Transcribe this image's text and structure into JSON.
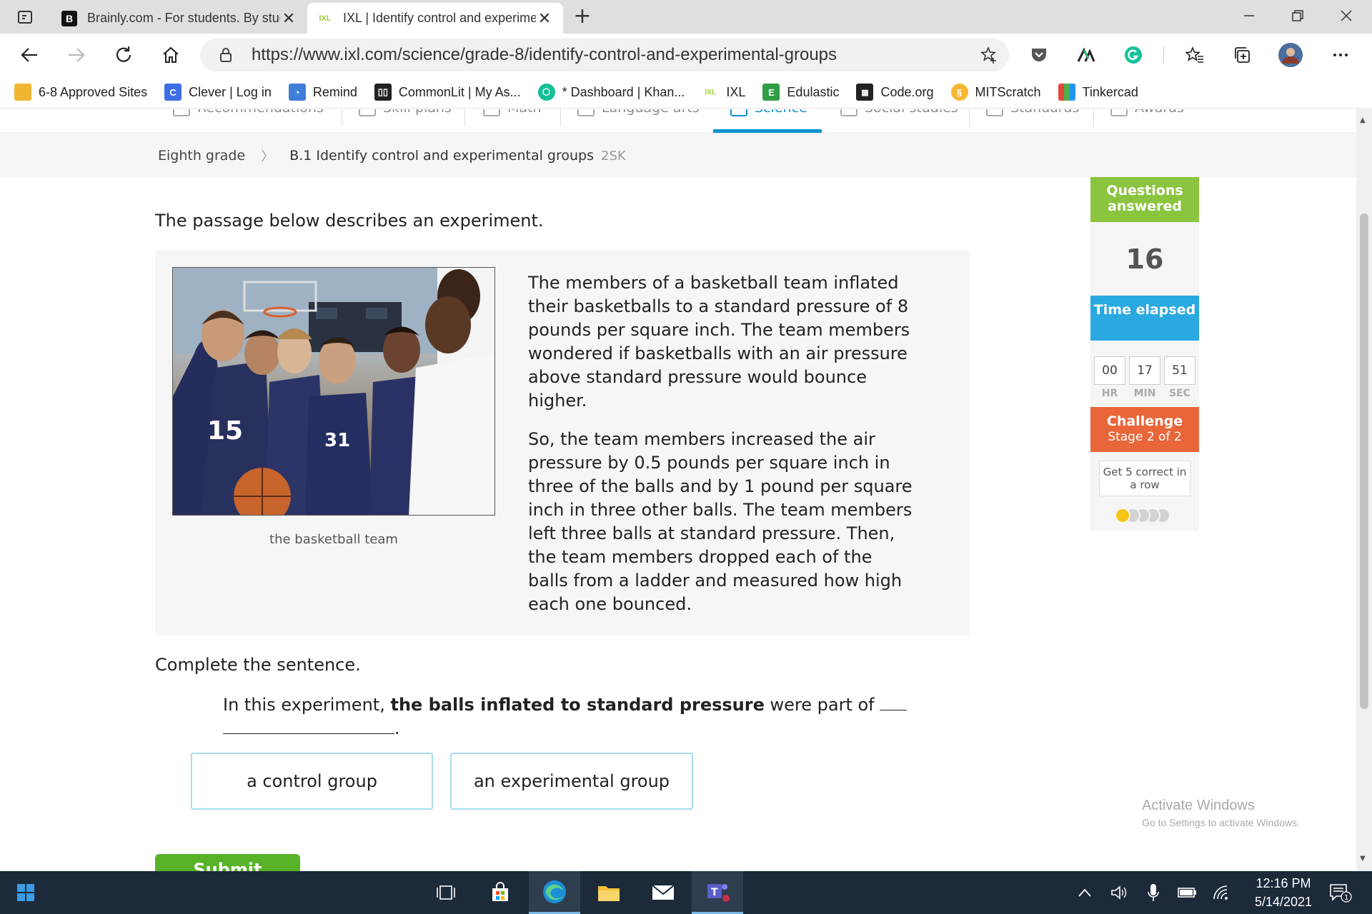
{
  "browser": {
    "tabs": [
      {
        "title": "Brainly.com - For students. By students.",
        "favicon": "B",
        "active": false
      },
      {
        "title": "IXL | Identify control and experimental groups",
        "favicon": "IXL",
        "active": true
      }
    ],
    "url": "https://www.ixl.com/science/grade-8/identify-control-and-experimental-groups",
    "bookmarks": [
      {
        "label": "6-8 Approved Sites",
        "icon": "folder-icon",
        "color": "#f2b531"
      },
      {
        "label": "Clever | Log in",
        "icon": "C",
        "color": "#3e6ee6"
      },
      {
        "label": "Remind",
        "icon": "remind-icon",
        "color": "#3f7ed8"
      },
      {
        "label": "CommonLit | My As...",
        "icon": "book-icon",
        "color": "#222222"
      },
      {
        "label": "* Dashboard | Khan...",
        "icon": "khan-icon",
        "color": "#14bf96"
      },
      {
        "label": "IXL",
        "icon": "IXL",
        "color": "#9ccc3b"
      },
      {
        "label": "Edulastic",
        "icon": "E",
        "color": "#2f9e44"
      },
      {
        "label": "Code.org",
        "icon": "code-icon",
        "color": "#222222"
      },
      {
        "label": "MITScratch",
        "icon": "scratch-icon",
        "color": "#f7b733"
      },
      {
        "label": "Tinkercad",
        "icon": "tinkercad-icon",
        "color": "#e8463a"
      }
    ]
  },
  "subnav": {
    "items": [
      "Recommendations",
      "Skill plans",
      "Math",
      "Language arts",
      "Science",
      "Social studies",
      "Standards",
      "Awards"
    ],
    "active": "Science"
  },
  "breadcrumb": {
    "grade": "Eighth grade",
    "skill": "B.1 Identify control and experimental groups",
    "code": "2SK"
  },
  "question": {
    "prompt": "The passage below describes an experiment.",
    "image_caption": "the basketball team",
    "passage_p1": "The members of a basketball team inflated their basketballs to a standard pressure of 8 pounds per square inch. The team members wondered if basketballs with an air pressure above standard pressure would bounce higher.",
    "passage_p2": "So, the team members increased the air pressure by 0.5 pounds per square inch in three of the balls and by 1 pound per square inch in three other balls. The team members left three balls at standard pressure. Then, the team members dropped each of the balls from a ladder and measured how high each one bounced.",
    "instruction": "Complete the sentence.",
    "sentence_start": "In this experiment,",
    "sentence_bold": "the balls inflated to standard pressure",
    "sentence_end": "were part of",
    "sentence_period": ".",
    "choices": [
      "a control group",
      "an experimental group"
    ],
    "submit_label": "Submit"
  },
  "sidebar": {
    "questions_answered_label": "Questions answered",
    "questions_answered": "16",
    "time_elapsed_label": "Time elapsed",
    "timer": {
      "hr": "00",
      "min": "17",
      "sec": "51",
      "hr_label": "HR",
      "min_label": "MIN",
      "sec_label": "SEC"
    },
    "challenge_label": "Challenge",
    "challenge_stage": "Stage 2 of 2",
    "challenge_goal": "Get 5 correct in a row",
    "progress_dots_filled": 1,
    "progress_dots_total": 5
  },
  "watermark": {
    "line1": "Activate Windows",
    "line2": "Go to Settings to activate Windows."
  },
  "taskbar": {
    "time": "12:16 PM",
    "date": "5/14/2021",
    "notification_count": "1"
  },
  "colors": {
    "ixl_blue": "#0e93d1",
    "questions_green": "#8bc43f",
    "time_blue": "#29a9e0",
    "challenge_orange": "#e8663a",
    "submit_green": "#57b228",
    "dot_filled": "#f5c518",
    "dot_empty": "#d3d3d3"
  }
}
